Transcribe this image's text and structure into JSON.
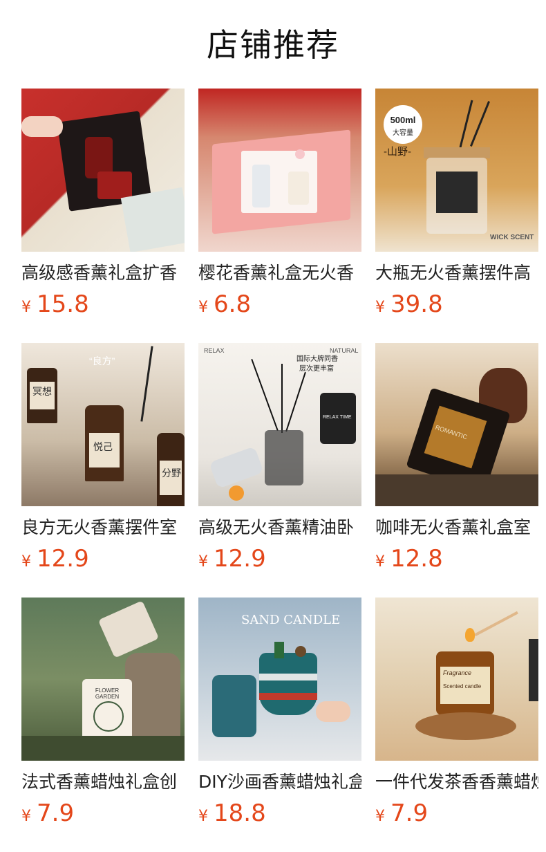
{
  "section": {
    "title": "店铺推荐"
  },
  "products": [
    {
      "name": "高级感香薰礼盒扩香",
      "currency": "¥",
      "price": "15.8"
    },
    {
      "name": "樱花香薰礼盒无火香",
      "currency": "¥",
      "price": "6.8"
    },
    {
      "name": "大瓶无火香薰摆件高",
      "currency": "¥",
      "price": "39.8",
      "image_text": {
        "badge_size": "500ml",
        "badge_label": "大容量",
        "series": "-山野-",
        "brand": "WICK SCENT"
      }
    },
    {
      "name": "良方无火香薰摆件室",
      "currency": "¥",
      "price": "12.9",
      "image_text": {
        "header": "“良方”",
        "label_1": "冥想",
        "label_2": "悦己",
        "label_3": "分野"
      }
    },
    {
      "name": "高级无火香薰精油卧",
      "currency": "¥",
      "price": "12.9",
      "image_text": {
        "left": "RELAX",
        "right": "NATURAL",
        "headline": "国际大牌同香",
        "sub": "层次更丰富",
        "bottle": "RELAX TIME"
      }
    },
    {
      "name": "咖啡无火香薰礼盒室",
      "currency": "¥",
      "price": "12.8",
      "image_text": {
        "label": "ROMANTIC"
      }
    },
    {
      "name": "法式香薰蜡烛礼盒创",
      "currency": "¥",
      "price": "7.9",
      "image_text": {
        "label": "FLOWER GARDEN"
      }
    },
    {
      "name": "DIY沙画香薰蜡烛礼盒",
      "currency": "¥",
      "price": "18.8",
      "image_text": {
        "headline": "SAND CANDLE"
      }
    },
    {
      "name": "一件代发茶香香薰蜡烛",
      "currency": "¥",
      "price": "7.9",
      "image_text": {
        "label": "Fragrance",
        "sub": "Scented candle"
      }
    }
  ]
}
